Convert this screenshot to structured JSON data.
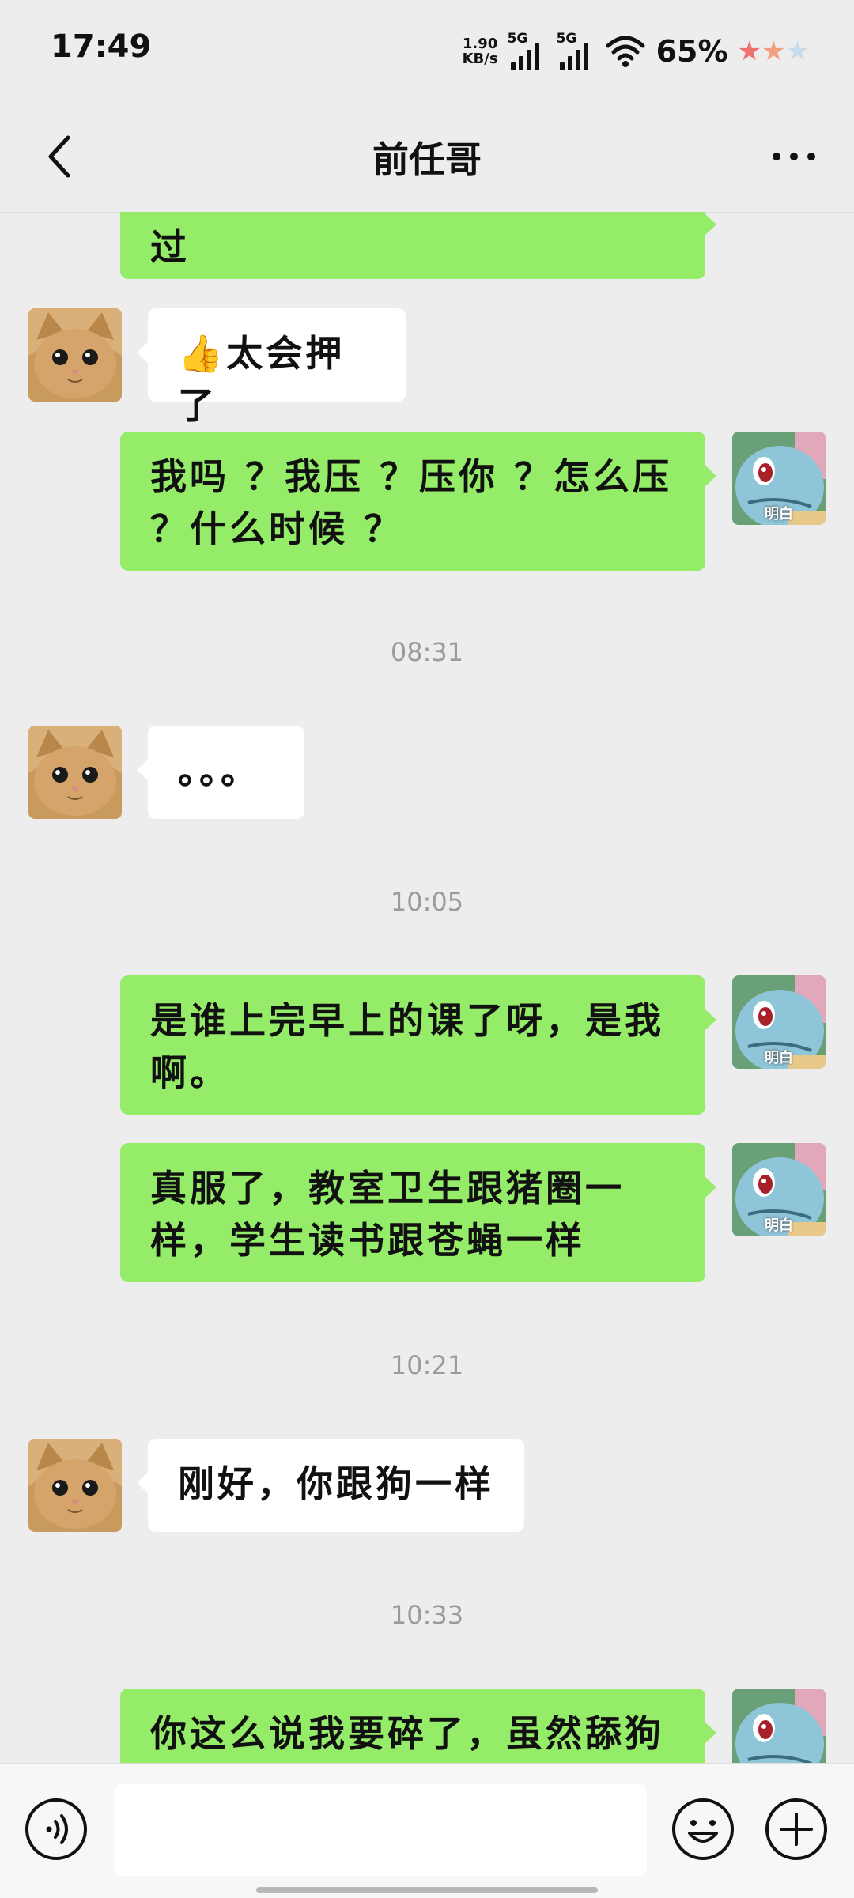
{
  "status_bar": {
    "time": "17:49",
    "net_speed_value": "1.90",
    "net_speed_unit": "KB/s",
    "signal_1_label": "5G",
    "signal_2_label": "5G",
    "battery": "65%"
  },
  "nav": {
    "title": "前任哥"
  },
  "messages": [
    {
      "side": "right",
      "text": "过"
    },
    {
      "side": "left",
      "text": "👍太会押了"
    },
    {
      "side": "right",
      "text": "我吗 ？我压 ？压你 ？怎么压 ？什么时候 ？"
    },
    {
      "time": "08:31"
    },
    {
      "side": "left",
      "text": "。。。"
    },
    {
      "time": "10:05"
    },
    {
      "side": "right",
      "text": "是谁上完早上的课了呀，是我啊。"
    },
    {
      "side": "right",
      "text": "真服了，教室卫生跟猪圈一样，学生读书跟苍蝇一样"
    },
    {
      "time": "10:21"
    },
    {
      "side": "left",
      "text": "刚好，你跟狗一样"
    },
    {
      "time": "10:33"
    },
    {
      "side": "right",
      "text": "你这么说我要碎了，虽然舔狗"
    }
  ],
  "avatar_caption": "明白",
  "input": {
    "value": ""
  },
  "colors": {
    "sent_bubble": "#95ec69",
    "received_bubble": "#ffffff",
    "background": "#ededed"
  },
  "icons": {
    "back": "chevron-left-icon",
    "more": "more-dots-icon",
    "voice": "voice-icon",
    "emoji": "emoji-icon",
    "plus": "plus-icon"
  }
}
